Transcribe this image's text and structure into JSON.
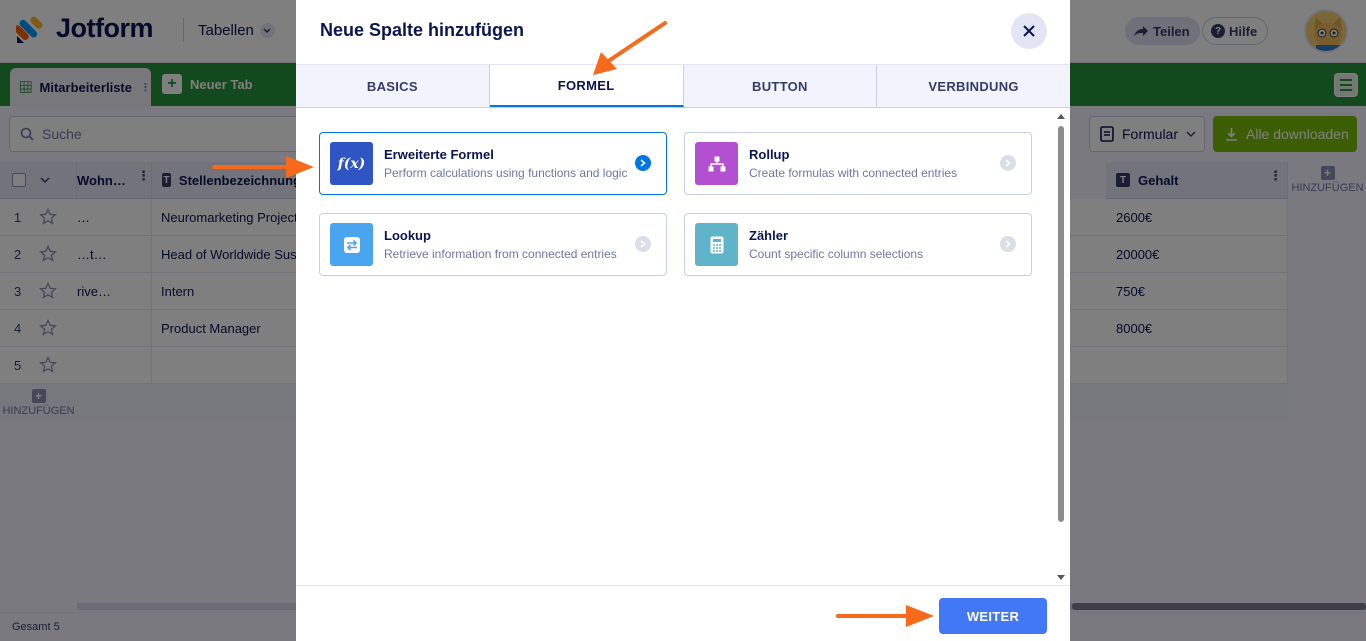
{
  "app": {
    "logo_text": "Jotform",
    "tables_label": "Tabellen",
    "share_label": "Teilen",
    "help_label": "Hilfe"
  },
  "tabs": {
    "active": "Mitarbeiterliste",
    "new": "Neuer Tab"
  },
  "toolbar": {
    "search_placeholder": "Suche",
    "form_label": "Formular",
    "download_label": "Alle downloaden"
  },
  "table": {
    "columns": [
      "Wohn…",
      "Stellenbezeichnung",
      "Gehalt"
    ],
    "add_column_label": "HINZUFÜGEN",
    "add_row_label": "HINZUFÜGEN",
    "rows": [
      {
        "num": "1",
        "wohn": "…",
        "title": "Neuromarketing Project",
        "salary": "2600€"
      },
      {
        "num": "2",
        "wohn": "…t…",
        "title": "Head of Worldwide Sust",
        "salary": "20000€"
      },
      {
        "num": "3",
        "wohn": "rive…",
        "title": "Intern",
        "salary": "750€"
      },
      {
        "num": "4",
        "wohn": "",
        "title": "Product Manager",
        "salary": "8000€"
      },
      {
        "num": "5",
        "wohn": "",
        "title": "",
        "salary": ""
      }
    ],
    "total_label": "Gesamt 5"
  },
  "modal": {
    "title": "Neue Spalte hinzufügen",
    "tabs": [
      "BASICS",
      "FORMEL",
      "BUTTON",
      "VERBINDUNG"
    ],
    "active_tab": "FORMEL",
    "cards": [
      {
        "title": "Erweiterte Formel",
        "desc": "Perform calculations using functions and logic",
        "icon": "function-icon",
        "color": "#2f54c4"
      },
      {
        "title": "Rollup",
        "desc": "Create formulas with connected entries",
        "icon": "hierarchy-icon",
        "color": "#b34fd1"
      },
      {
        "title": "Lookup",
        "desc": "Retrieve information from connected entries",
        "icon": "swap-icon",
        "color": "#4aa5f0"
      },
      {
        "title": "Zähler",
        "desc": "Count specific column selections",
        "icon": "calculator-icon",
        "color": "#5fb4c9"
      }
    ],
    "next_label": "WEITER"
  },
  "colors": {
    "accent_blue": "#4277f6",
    "tab_green": "#27953b",
    "download_green": "#78bb07",
    "annotation_orange": "#f76a1c"
  }
}
